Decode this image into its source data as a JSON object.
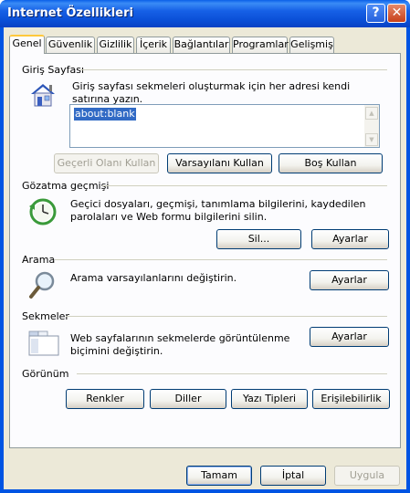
{
  "window": {
    "title": "Internet Özellikleri",
    "help_label": "?",
    "close_label": "✕"
  },
  "tabs": [
    {
      "label": "Genel",
      "active": true
    },
    {
      "label": "Güvenlik"
    },
    {
      "label": "Gizlilik"
    },
    {
      "label": "İçerik"
    },
    {
      "label": "Bağlantılar"
    },
    {
      "label": "Programlar"
    },
    {
      "label": "Gelişmiş"
    }
  ],
  "homepage": {
    "title": "Giriş Sayfası",
    "description": "Giriş sayfası sekmeleri oluşturmak için her adresi kendi satırına yazın.",
    "url_value": "about:blank",
    "use_current_label": "Geçerli Olanı Kullan",
    "use_default_label": "Varsayılanı Kullan",
    "use_blank_label": "Boş Kullan",
    "icon": "house-icon"
  },
  "history": {
    "title": "Gözatma geçmişi",
    "description": "Geçici dosyaları, geçmişi, tanımlama bilgilerini, kaydedilen parolaları ve Web formu bilgilerini silin.",
    "delete_label": "Sil...",
    "settings_label": "Ayarlar",
    "icon": "history-clock-icon"
  },
  "search": {
    "title": "Arama",
    "description": "Arama varsayılanlarını değiştirin.",
    "settings_label": "Ayarlar",
    "icon": "magnifier-icon"
  },
  "tabs_section": {
    "title": "Sekmeler",
    "description": "Web sayfalarının sekmelerde görüntülenme biçimini değiştirin.",
    "settings_label": "Ayarlar",
    "icon": "tabs-window-icon"
  },
  "appearance": {
    "title": "Görünüm",
    "colors_label": "Renkler",
    "languages_label": "Diller",
    "fonts_label": "Yazı Tipleri",
    "accessibility_label": "Erişilebilirlik"
  },
  "footer": {
    "ok_label": "Tamam",
    "cancel_label": "İptal",
    "apply_label": "Uygula"
  },
  "colors": {
    "titlebar": "#0054e3",
    "dialog_face": "#ece9d8",
    "selection": "#316ac5",
    "active_tab_accent": "#ffc83c"
  }
}
